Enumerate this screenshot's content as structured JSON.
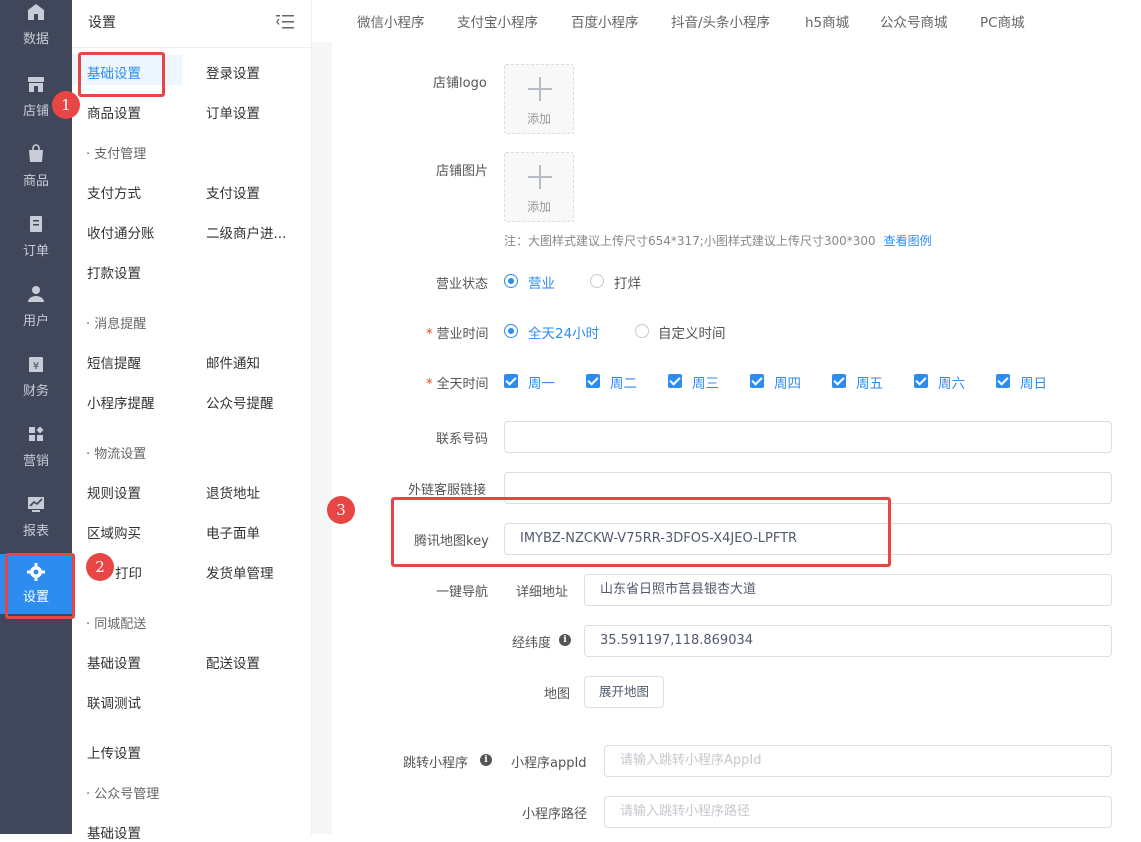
{
  "rail": {
    "items": [
      {
        "label": "数据",
        "icon": "home-icon"
      },
      {
        "label": "店铺",
        "icon": "store-icon"
      },
      {
        "label": "商品",
        "icon": "bag-icon"
      },
      {
        "label": "订单",
        "icon": "order-icon"
      },
      {
        "label": "用户",
        "icon": "user-icon"
      },
      {
        "label": "财务",
        "icon": "finance-icon"
      },
      {
        "label": "营销",
        "icon": "marketing-icon"
      },
      {
        "label": "报表",
        "icon": "report-icon"
      },
      {
        "label": "设置",
        "icon": "gear-icon"
      }
    ]
  },
  "submenu": {
    "title": "设置",
    "items": {
      "basic": "基础设置",
      "login": "登录设置",
      "goods": "商品设置",
      "order": "订单设置",
      "pay_section": "· 支付管理",
      "pay_method": "支付方式",
      "pay_settings": "支付设置",
      "split": "收付通分账",
      "sub_merchant": "二级商户进...",
      "payout": "打款设置",
      "msg_section": "· 消息提醒",
      "sms": "短信提醒",
      "mail": "邮件通知",
      "mini_notice": "小程序提醒",
      "mp_notice": "公众号提醒",
      "logistics_section": "· 物流设置",
      "rules": "规则设置",
      "return_addr": "退货地址",
      "region": "区域购买",
      "e_waybill": "电子面单",
      "print": "打印",
      "ship_manage": "发货单管理",
      "city_section": "· 同城配送",
      "city_basic": "基础设置",
      "delivery": "配送设置",
      "debug": "联调测试",
      "upload": "上传设置",
      "mp_section": "· 公众号管理",
      "mp_basic": "基础设置"
    }
  },
  "tabs": [
    "微信小程序",
    "支付宝小程序",
    "百度小程序",
    "抖音/头条小程序",
    "h5商城",
    "公众号商城",
    "PC商城"
  ],
  "form": {
    "logo_label": "店铺logo",
    "image_label": "店铺图片",
    "add_text": "添加",
    "note": "注：大图样式建议上传尺寸654*317;小图样式建议上传尺寸300*300",
    "note_link": "查看图例",
    "status_label": "营业状态",
    "status_open": "营业",
    "status_closed": "打烊",
    "hours_label": "营业时间",
    "hours_all": "全天24小时",
    "hours_custom": "自定义时间",
    "days_label": "全天时间",
    "days": [
      "周一",
      "周二",
      "周三",
      "周四",
      "周五",
      "周六",
      "周日"
    ],
    "phone_label": "联系号码",
    "phone_value": "",
    "cs_label": "外链客服链接",
    "cs_value": "",
    "map_key_label": "腾讯地图key",
    "map_key_value": "IMYBZ-NZCKW-V75RR-3DFOS-X4JEO-LPFTR",
    "nav_label": "一键导航",
    "address_label": "详细地址",
    "address_value": "山东省日照市莒县银杏大道",
    "latlng_label": "经纬度",
    "latlng_value": "35.591197,118.869034",
    "map_label": "地图",
    "map_button": "展开地图",
    "jump_label": "跳转小程序",
    "appid_label": "小程序appId",
    "appid_placeholder": "请输入跳转小程序AppId",
    "path_label": "小程序路径",
    "path_placeholder": "请输入跳转小程序路径"
  },
  "annotations": [
    "1",
    "2",
    "3"
  ],
  "colors": {
    "accent": "#2d8cf0",
    "rail": "#40475a",
    "annotation": "#e84545"
  }
}
